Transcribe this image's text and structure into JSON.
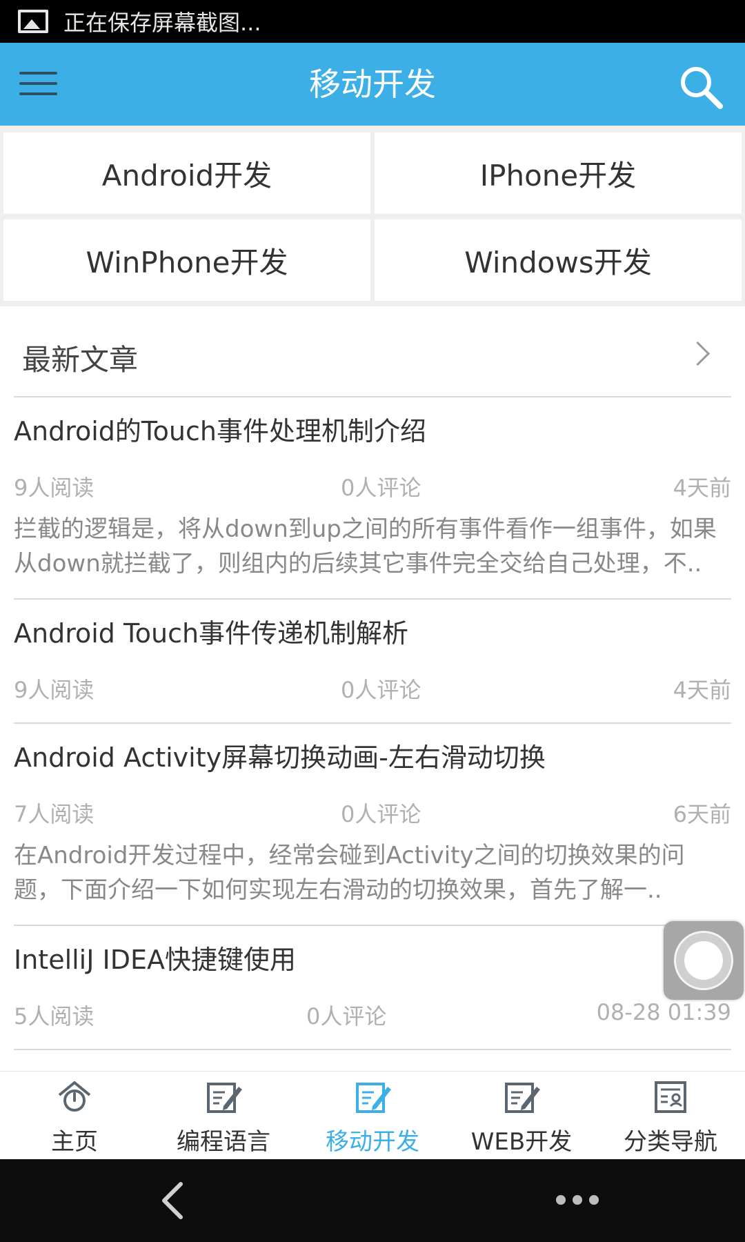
{
  "status_bar": {
    "text": "正在保存屏幕截图..."
  },
  "app_bar": {
    "title": "移动开发"
  },
  "categories": [
    {
      "label": "Android开发"
    },
    {
      "label": "IPhone开发"
    },
    {
      "label": "WinPhone开发"
    },
    {
      "label": "Windows开发"
    }
  ],
  "section": {
    "title": "最新文章"
  },
  "articles": [
    {
      "title": " Android的Touch事件处理机制介绍",
      "reads": "9人阅读",
      "comments": "0人评论",
      "time": "4天前",
      "summary": "拦截的逻辑是，将从down到up之间的所有事件看作一组事件，如果从down就拦截了，则组内的后续其它事件完全交给自己处理，不.."
    },
    {
      "title": "Android Touch事件传递机制解析",
      "reads": "9人阅读",
      "comments": "0人评论",
      "time": "4天前"
    },
    {
      "title": " Android Activity屏幕切换动画-左右滑动切换",
      "reads": "7人阅读",
      "comments": "0人评论",
      "time": "6天前",
      "summary": "在Android开发过程中，经常会碰到Activity之间的切换效果的问题，下面介绍一下如何实现左右滑动的切换效果，首先了解一.."
    },
    {
      "title": "IntelliJ IDEA快捷键使用",
      "reads": "5人阅读",
      "comments": "0人评论",
      "time": "08-28 01:39"
    }
  ],
  "bottom_nav": [
    {
      "label": "主页",
      "icon": "home-icon"
    },
    {
      "label": "编程语言",
      "icon": "edit-icon"
    },
    {
      "label": "移动开发",
      "icon": "edit-icon",
      "active": true
    },
    {
      "label": "WEB开发",
      "icon": "edit-icon"
    },
    {
      "label": "分类导航",
      "icon": "profile-card-icon"
    }
  ],
  "colors": {
    "accent": "#3cb0e6",
    "text": "#333333",
    "muted": "#b0b0b0"
  }
}
